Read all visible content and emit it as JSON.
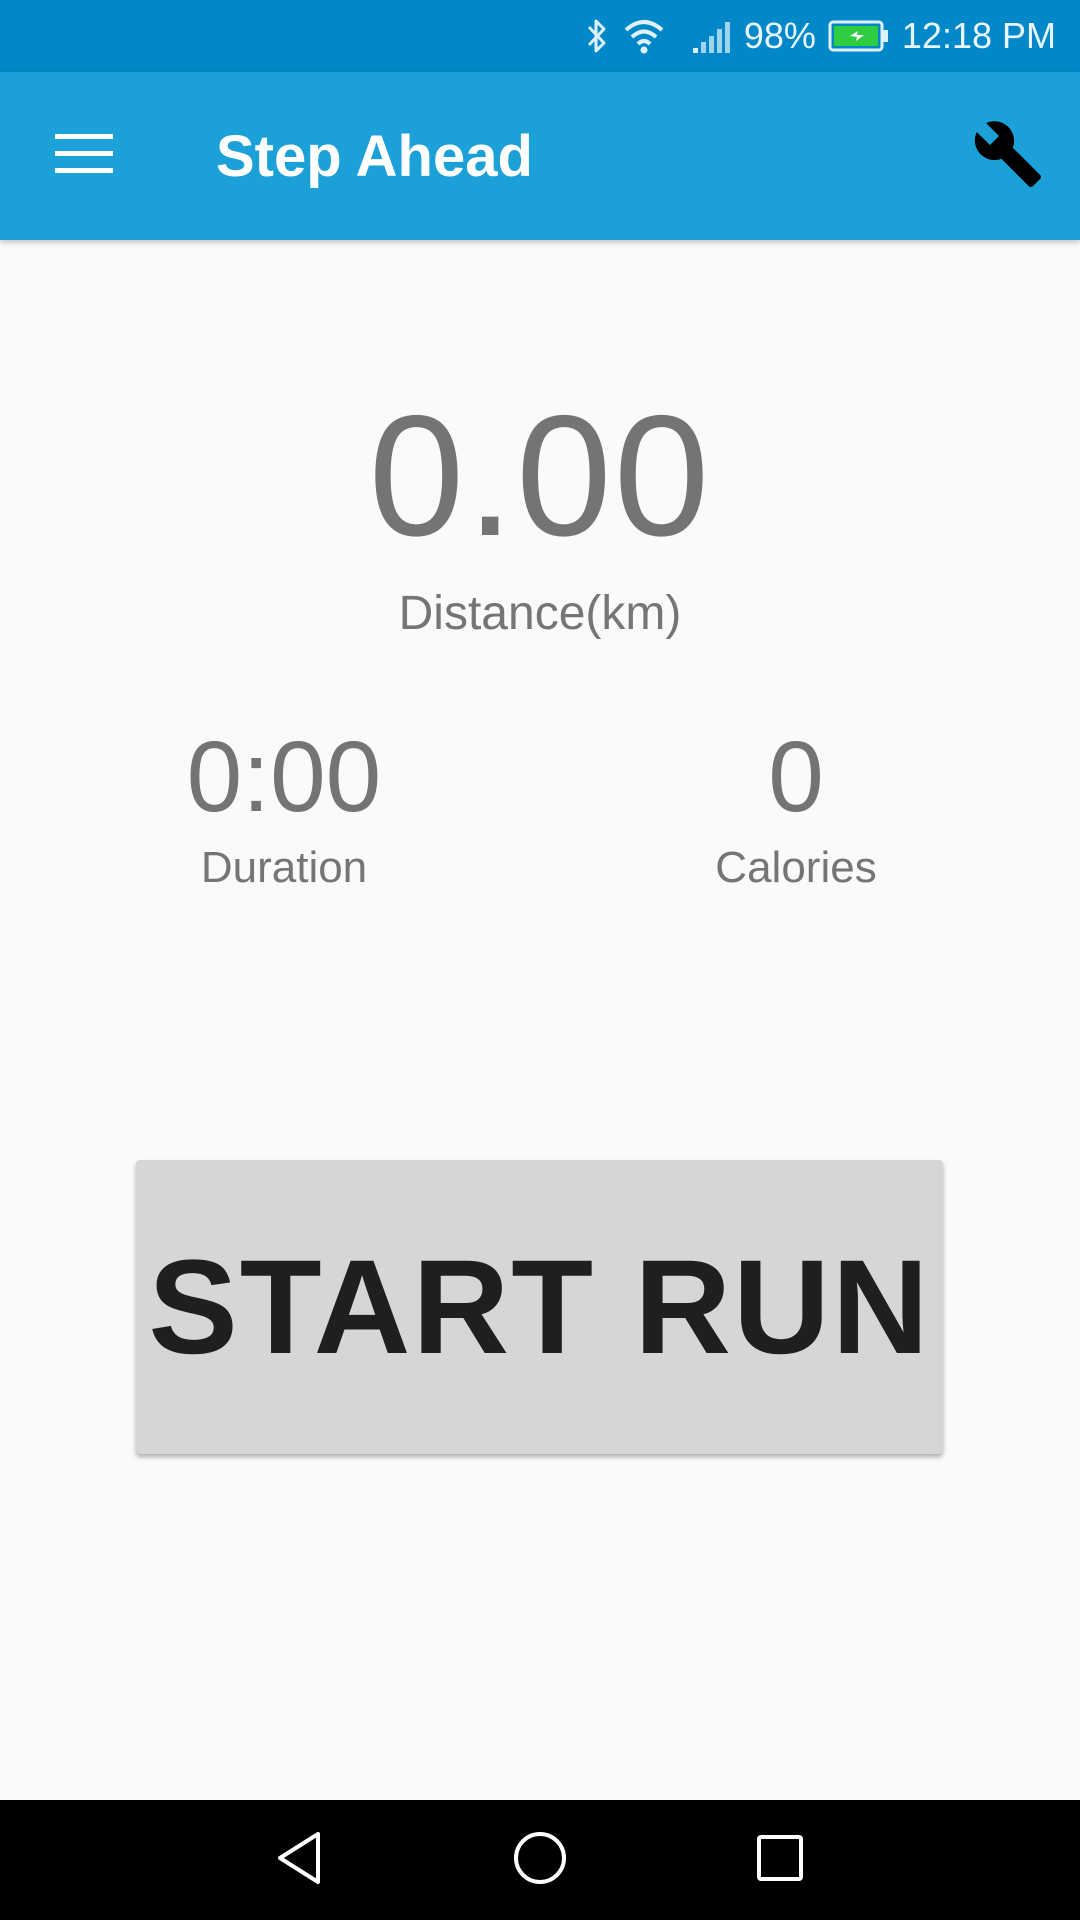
{
  "status_bar": {
    "battery_percent": "98%",
    "time": "12:18 PM",
    "icons": [
      "bluetooth-icon",
      "wifi-icon",
      "signal-icon",
      "battery-charging-icon"
    ]
  },
  "app_bar": {
    "title": "Step Ahead",
    "menu_icon": "hamburger-menu-icon",
    "settings_icon": "wrench-icon"
  },
  "stats": {
    "distance": {
      "value": "0.00",
      "label": "Distance(km)"
    },
    "duration": {
      "value": "0:00",
      "label": "Duration"
    },
    "calories": {
      "value": "0",
      "label": "Calories"
    }
  },
  "actions": {
    "start_run_label": "START RUN"
  },
  "nav_bar": {
    "icons": [
      "back-icon",
      "home-icon",
      "recents-icon"
    ]
  },
  "colors": {
    "status_bar": "#0288c9",
    "app_bar": "#1ba0d8",
    "background": "#fafafa",
    "button": "#d6d6d6",
    "stat_text": "#747474",
    "battery_fill": "#2ecc40"
  }
}
